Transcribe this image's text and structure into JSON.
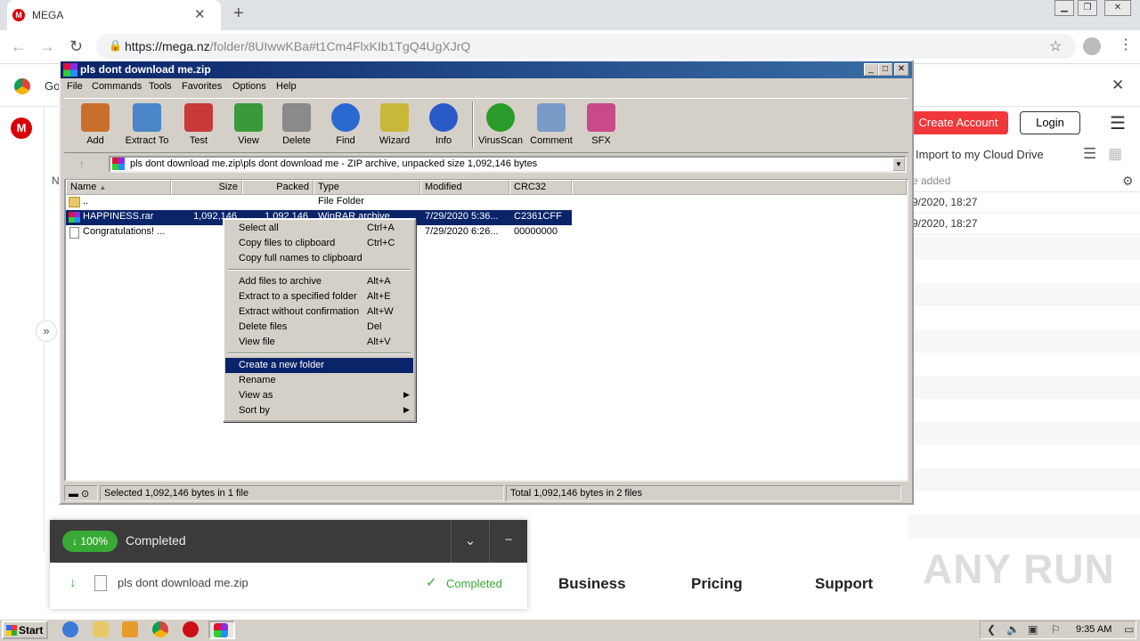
{
  "browser": {
    "tab_title": "MEGA",
    "tab_icon": "M",
    "url_host": "https://mega.nz",
    "url_path": "/folder/8UIwwKBa#t1Cm4FlxKIb1TgQ4UgXJrQ",
    "infobar_text": "Go"
  },
  "mega": {
    "logo": "M",
    "create_account": "Create Account",
    "login": "Login",
    "import_label": "Import to my Cloud Drive",
    "col_date": "e added",
    "col_n": "N",
    "rows": [
      "9/2020, 18:27",
      "9/2020, 18:27"
    ],
    "footer": [
      "Business",
      "Pricing",
      "Support"
    ],
    "watermark": "ANY RUN"
  },
  "transfer": {
    "percent": "100%",
    "header_status": "Completed",
    "file_name": "pls dont download me.zip",
    "file_status": "Completed",
    "progress_fraction": 1.0
  },
  "winrar": {
    "title": "pls dont download me.zip",
    "menu": [
      "File",
      "Commands",
      "Tools",
      "Favorites",
      "Options",
      "Help"
    ],
    "tools": [
      {
        "label": "Add",
        "color": "#c8702a"
      },
      {
        "label": "Extract To",
        "color": "#4a86c8"
      },
      {
        "label": "Test",
        "color": "#c83a3a"
      },
      {
        "label": "View",
        "color": "#3a9a3a"
      },
      {
        "label": "Delete",
        "color": "#8a8a8a"
      },
      {
        "label": "Find",
        "color": "#2a6ad0"
      },
      {
        "label": "Wizard",
        "color": "#c8b83a"
      },
      {
        "label": "Info",
        "color": "#2a5ac8"
      },
      {
        "label": "VirusScan",
        "color": "#2a9a2a"
      },
      {
        "label": "Comment",
        "color": "#7a9ac8"
      },
      {
        "label": "SFX",
        "color": "#c84a8a"
      }
    ],
    "path": "pls dont download me.zip\\pls dont download me - ZIP archive, unpacked size 1,092,146 bytes",
    "columns": [
      "Name",
      "Size",
      "Packed",
      "Type",
      "Modified",
      "CRC32"
    ],
    "files": [
      {
        "name": "..",
        "size": "",
        "packed": "",
        "type": "File Folder",
        "modified": "",
        "crc": ""
      },
      {
        "name": "HAPPINESS.rar",
        "size": "1,092,146",
        "packed": "1,092,146",
        "type": "WinRAR archive",
        "modified": "7/29/2020 5:36...",
        "crc": "C2361CFF"
      },
      {
        "name": "Congratulations! ...",
        "size": "",
        "packed": "",
        "type": "",
        "modified": "7/29/2020 6:26...",
        "crc": "00000000"
      }
    ],
    "status_left": "Selected 1,092,146 bytes in 1 file",
    "status_right": "Total 1,092,146 bytes in 2 files"
  },
  "context_menu": [
    {
      "label": "Select all",
      "key": "Ctrl+A"
    },
    {
      "label": "Copy files to clipboard",
      "key": "Ctrl+C"
    },
    {
      "label": "Copy full names to clipboard",
      "key": ""
    },
    {
      "label": "Add files to archive",
      "key": "Alt+A"
    },
    {
      "label": "Extract to a specified folder",
      "key": "Alt+E"
    },
    {
      "label": "Extract without confirmation",
      "key": "Alt+W"
    },
    {
      "label": "Delete files",
      "key": "Del"
    },
    {
      "label": "View file",
      "key": "Alt+V"
    },
    {
      "label": "Create a new folder",
      "key": ""
    },
    {
      "label": "Rename",
      "key": ""
    },
    {
      "label": "View as",
      "key": ""
    },
    {
      "label": "Sort by",
      "key": ""
    }
  ],
  "taskbar": {
    "start": "Start",
    "clock": "9:35 AM"
  }
}
